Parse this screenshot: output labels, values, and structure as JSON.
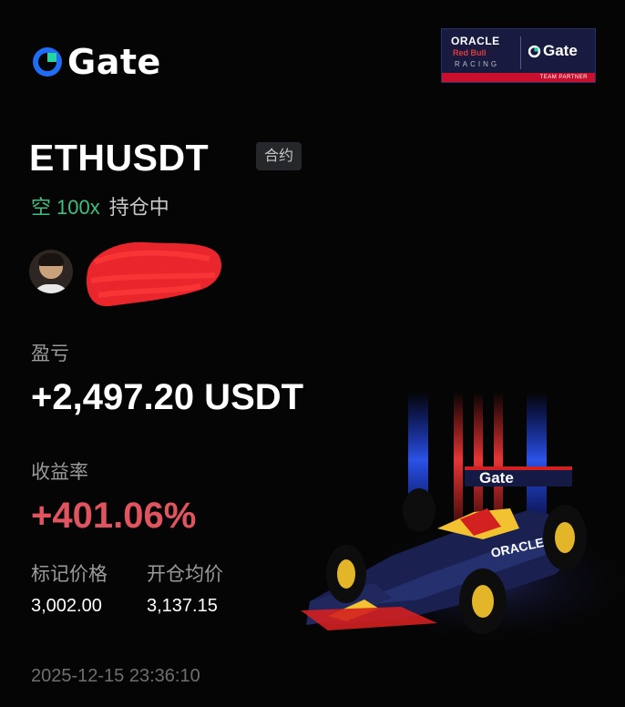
{
  "brand": {
    "name": "Gate",
    "accent": "#1f6cf5"
  },
  "partner": {
    "oracle": "ORACLE",
    "redbull": "Red Bull",
    "racing": "RACING",
    "gate": "Gate",
    "tag": "TEAM PARTNER"
  },
  "position": {
    "symbol": "ETHUSDT",
    "type_badge": "合约",
    "direction": "空",
    "leverage": "100x",
    "status": "持仓中"
  },
  "pnl": {
    "label": "盈亏",
    "value": "+2,497.20 USDT"
  },
  "roi": {
    "label": "收益率",
    "value": "+401.06%",
    "color": "#e0545f"
  },
  "prices": {
    "mark_label": "标记价格",
    "mark_value": "3,002.00",
    "open_label": "开仓均价",
    "open_value": "3,137.15"
  },
  "timestamp": "2025-12-15 23:36:10",
  "car_livery": {
    "wing_text": "Gate",
    "sidepod_text": "ORACLE"
  }
}
